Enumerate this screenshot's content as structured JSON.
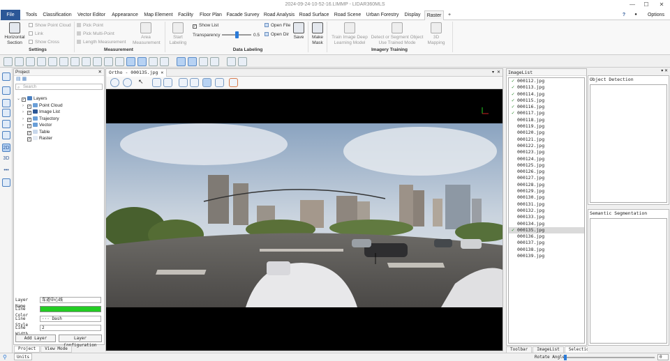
{
  "window": {
    "title": "2024-09-24-10-52-16.LIMMP - LIDAR360MLS",
    "min": "—",
    "max": "☐",
    "close": "✕"
  },
  "menu": {
    "file": "File",
    "tabs": [
      "Tools",
      "Classification",
      "Vector Editor",
      "Appearance",
      "Map Element",
      "Facility",
      "Floor Plan",
      "Facade Survey",
      "Road Analysis",
      "Road Surface",
      "Road Scene",
      "Urban Forestry",
      "Display",
      "Raster"
    ],
    "plus": "+",
    "help": "?",
    "options": "Options"
  },
  "ribbon": {
    "horizontal_section": "Horizontal Section",
    "show_point_cloud": "Show Point Cloud",
    "link": "Link",
    "show_cross": "Show Cross",
    "group_settings": "Settings",
    "pick_point": "Pick Point",
    "pick_multi_point": "Pick Multi-Point",
    "length_measurement": "Length Measurement",
    "area_measurement": "Area Measurement",
    "group_measurement": "Measurement",
    "start_labeling": "Start Labeling",
    "show_list": "Show List",
    "transparency": "Transparency",
    "transparency_value": "0.5",
    "transparency_level": 0.5,
    "open_file": "Open File",
    "open_dir": "Open Dir",
    "save": "Save",
    "group_data_labeling": "Data Labeling",
    "make_mask": "Make Mask",
    "train_deep": "Train Image Deep Learning Model",
    "detect_segment": "Detect or Segment Object Use Trained Mode",
    "mapping_3d": "3D Mapping",
    "group_imagery_training": "Imagery Training"
  },
  "project": {
    "title": "Project",
    "search_placeholder": "Search",
    "tree": {
      "root": "Layers",
      "items": [
        "Point Cloud",
        "Image List",
        "Trajectory",
        "Vector",
        "Table",
        "Raster"
      ]
    },
    "props": {
      "layer_name_label": "Layer Name",
      "layer_name_value": "车道中心线",
      "line_color_label": "Line Color",
      "line_color": "#22cc22",
      "line_style_label": "Line Style",
      "line_style_value": "··· Dash",
      "line_width_label": "Line Width",
      "line_width_value": "2",
      "add_layer": "Add Layer",
      "layer_config": "Layer Configuration"
    },
    "bottom_tabs": [
      "Project",
      "View Mode"
    ]
  },
  "viewer": {
    "tab_label": "Ortho - 000135.jpg"
  },
  "imagelist": {
    "title": "ImageList",
    "items": [
      {
        "name": "000112.jpg",
        "checked": true
      },
      {
        "name": "000113.jpg",
        "checked": true
      },
      {
        "name": "000114.jpg",
        "checked": true
      },
      {
        "name": "000115.jpg",
        "checked": true
      },
      {
        "name": "000116.jpg",
        "checked": true
      },
      {
        "name": "000117.jpg",
        "checked": true
      },
      {
        "name": "000118.jpg",
        "checked": false
      },
      {
        "name": "000119.jpg",
        "checked": false
      },
      {
        "name": "000120.jpg",
        "checked": false
      },
      {
        "name": "000121.jpg",
        "checked": false
      },
      {
        "name": "000122.jpg",
        "checked": false
      },
      {
        "name": "000123.jpg",
        "checked": false
      },
      {
        "name": "000124.jpg",
        "checked": false
      },
      {
        "name": "000125.jpg",
        "checked": false
      },
      {
        "name": "000126.jpg",
        "checked": false
      },
      {
        "name": "000127.jpg",
        "checked": false
      },
      {
        "name": "000128.jpg",
        "checked": false
      },
      {
        "name": "000129.jpg",
        "checked": false
      },
      {
        "name": "000130.jpg",
        "checked": false
      },
      {
        "name": "000131.jpg",
        "checked": false
      },
      {
        "name": "000132.jpg",
        "checked": false
      },
      {
        "name": "000133.jpg",
        "checked": false
      },
      {
        "name": "000134.jpg",
        "checked": false
      },
      {
        "name": "000135.jpg",
        "checked": true,
        "selected": true
      },
      {
        "name": "000136.jpg",
        "checked": false
      },
      {
        "name": "000137.jpg",
        "checked": false
      },
      {
        "name": "000138.jpg",
        "checked": false
      },
      {
        "name": "000139.jpg",
        "checked": false
      }
    ],
    "bottom_tabs": [
      "Toolbar",
      "ImageList",
      "Selection"
    ]
  },
  "right": {
    "object_detection": "Object Detection",
    "semantic_segmentation": "Semantic Segmentation"
  },
  "status": {
    "units": "Units",
    "rotate_angle_label": "Rotate Angle:",
    "rotate_angle_value": "0"
  }
}
